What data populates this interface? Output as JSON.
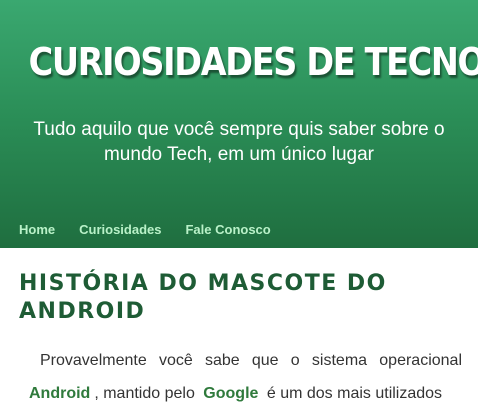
{
  "header": {
    "site_title": "CURIOSIDADES DE TECNOLOGIA",
    "tagline": "Tudo aquilo que você sempre quis saber sobre o mundo Tech, em um único lugar"
  },
  "nav": {
    "items": [
      {
        "label": "Home"
      },
      {
        "label": "Curiosidades"
      },
      {
        "label": "Fale Conosco"
      }
    ]
  },
  "post": {
    "title": "História do Mascote do Android",
    "body": {
      "part1": "Provavelmente você sabe que o sistema operacional",
      "highlight1": "Android",
      "part2": ", mantido pelo",
      "highlight2": "Google",
      "part3": "é um dos mais utilizados"
    }
  },
  "colors": {
    "header_top": "#3aa870",
    "header_bottom": "#1f6e3f",
    "nav_link": "#b9f1c8",
    "post_title": "#1e5c35",
    "highlight": "#2f7a3c"
  }
}
